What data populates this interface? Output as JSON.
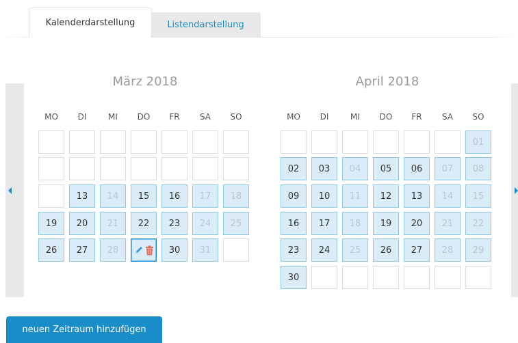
{
  "tabs": {
    "calendar_label": "Kalenderdarstellung",
    "list_label": "Listendarstellung"
  },
  "weekdays": [
    "MO",
    "DI",
    "MI",
    "DO",
    "FR",
    "SA",
    "SO"
  ],
  "months": [
    {
      "title": "März 2018",
      "rows": [
        [
          {
            "d": ""
          },
          {
            "d": ""
          },
          {
            "d": ""
          },
          {
            "d": ""
          },
          {
            "d": ""
          },
          {
            "d": ""
          },
          {
            "d": ""
          }
        ],
        [
          {
            "d": ""
          },
          {
            "d": ""
          },
          {
            "d": ""
          },
          {
            "d": ""
          },
          {
            "d": ""
          },
          {
            "d": ""
          },
          {
            "d": ""
          }
        ],
        [
          {
            "d": ""
          },
          {
            "d": "13",
            "sel": true
          },
          {
            "d": "14",
            "sel": true,
            "muted": true
          },
          {
            "d": "15",
            "sel": true
          },
          {
            "d": "16",
            "sel": true
          },
          {
            "d": "17",
            "sel": true,
            "muted": true
          },
          {
            "d": "18",
            "sel": true,
            "muted": true
          }
        ],
        [
          {
            "d": "19",
            "sel": true
          },
          {
            "d": "20",
            "sel": true
          },
          {
            "d": "21",
            "sel": true,
            "muted": true
          },
          {
            "d": "22",
            "sel": true
          },
          {
            "d": "23",
            "sel": true
          },
          {
            "d": "24",
            "sel": true,
            "muted": true
          },
          {
            "d": "25",
            "sel": true,
            "muted": true
          }
        ],
        [
          {
            "d": "26",
            "sel": true
          },
          {
            "d": "27",
            "sel": true
          },
          {
            "d": "28",
            "sel": true,
            "muted": true
          },
          {
            "d": "",
            "edit": true
          },
          {
            "d": "30",
            "sel": true
          },
          {
            "d": "31",
            "sel": true,
            "muted": true
          },
          {
            "d": ""
          }
        ]
      ]
    },
    {
      "title": "April 2018",
      "rows": [
        [
          {
            "d": ""
          },
          {
            "d": ""
          },
          {
            "d": ""
          },
          {
            "d": ""
          },
          {
            "d": ""
          },
          {
            "d": ""
          },
          {
            "d": "01",
            "sel": true,
            "muted": true
          }
        ],
        [
          {
            "d": "02",
            "sel": true
          },
          {
            "d": "03",
            "sel": true
          },
          {
            "d": "04",
            "sel": true,
            "muted": true
          },
          {
            "d": "05",
            "sel": true
          },
          {
            "d": "06",
            "sel": true
          },
          {
            "d": "07",
            "sel": true,
            "muted": true
          },
          {
            "d": "08",
            "sel": true,
            "muted": true
          }
        ],
        [
          {
            "d": "09",
            "sel": true
          },
          {
            "d": "10",
            "sel": true
          },
          {
            "d": "11",
            "sel": true,
            "muted": true
          },
          {
            "d": "12",
            "sel": true
          },
          {
            "d": "13",
            "sel": true
          },
          {
            "d": "14",
            "sel": true,
            "muted": true
          },
          {
            "d": "15",
            "sel": true,
            "muted": true
          }
        ],
        [
          {
            "d": "16",
            "sel": true
          },
          {
            "d": "17",
            "sel": true
          },
          {
            "d": "18",
            "sel": true,
            "muted": true
          },
          {
            "d": "19",
            "sel": true
          },
          {
            "d": "20",
            "sel": true
          },
          {
            "d": "21",
            "sel": true,
            "muted": true
          },
          {
            "d": "22",
            "sel": true,
            "muted": true
          }
        ],
        [
          {
            "d": "23",
            "sel": true
          },
          {
            "d": "24",
            "sel": true
          },
          {
            "d": "25",
            "sel": true,
            "muted": true
          },
          {
            "d": "26",
            "sel": true
          },
          {
            "d": "27",
            "sel": true
          },
          {
            "d": "28",
            "sel": true,
            "muted": true
          },
          {
            "d": "29",
            "sel": true,
            "muted": true
          }
        ],
        [
          {
            "d": "30",
            "sel": true
          },
          {
            "d": ""
          },
          {
            "d": ""
          },
          {
            "d": ""
          },
          {
            "d": ""
          },
          {
            "d": ""
          },
          {
            "d": ""
          }
        ]
      ]
    }
  ],
  "icons": {
    "prev": "chevron-left-icon",
    "next": "chevron-right-icon",
    "edit": "pencil-icon",
    "delete": "trash-icon"
  },
  "colors": {
    "accent": "#1a8cc7",
    "selected_bg": "#d9ecf8",
    "selected_border": "#8fc8e6",
    "delete": "#e07060"
  },
  "actions": {
    "add_label": "neuen Zeitraum hinzufügen"
  }
}
